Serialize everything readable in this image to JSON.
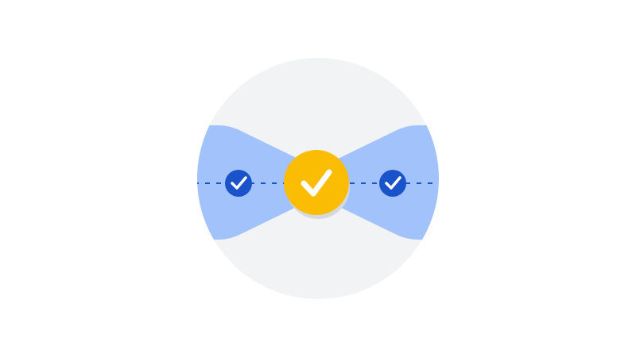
{
  "colors": {
    "page_background": "#ffffff",
    "circle_background": "#f1f3f4",
    "band_fill": "#a1c2fa",
    "dash_line": "#1a53c9",
    "small_check_circle": "#1a53c9",
    "center_check_circle": "#fbbc04",
    "center_shadow": "#d5d9dd",
    "check_mark": "#ffffff"
  },
  "icons": {
    "left": "check-circle-icon",
    "center": "check-circle-icon",
    "right": "check-circle-icon"
  }
}
